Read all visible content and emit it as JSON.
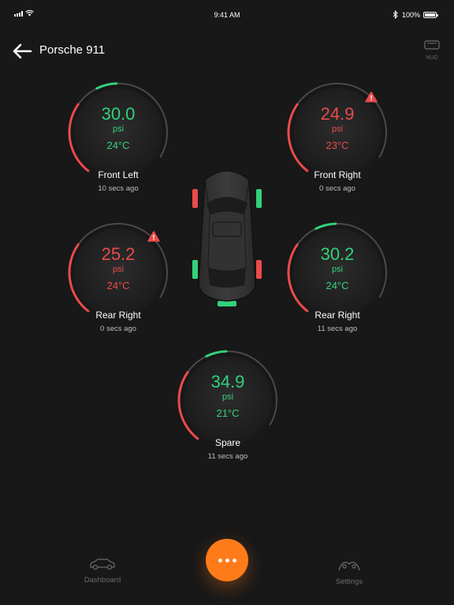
{
  "status": {
    "time": "9:41 AM",
    "battery": "100%"
  },
  "header": {
    "title": "Porsche 911",
    "hud_label": "HUD"
  },
  "colors": {
    "ok": "#33d17a",
    "warn": "#ea4b4b",
    "accent": "#ff7b1a",
    "background": "#181818"
  },
  "tires": [
    {
      "id": "front-left",
      "name": "Front Left",
      "pressure": "30.0",
      "unit": "psi",
      "temp": "24°C",
      "updated": "10 secs ago",
      "status": "ok",
      "alert": false
    },
    {
      "id": "front-right",
      "name": "Front Right",
      "pressure": "24.9",
      "unit": "psi",
      "temp": "23°C",
      "updated": "0 secs ago",
      "status": "warn",
      "alert": true
    },
    {
      "id": "rear-left",
      "name": "Rear Right",
      "pressure": "25.2",
      "unit": "psi",
      "temp": "24°C",
      "updated": "0 secs ago",
      "status": "warn",
      "alert": true
    },
    {
      "id": "rear-right",
      "name": "Rear Right",
      "pressure": "30.2",
      "unit": "psi",
      "temp": "24°C",
      "updated": "11 secs ago",
      "status": "ok",
      "alert": false
    },
    {
      "id": "spare",
      "name": "Spare",
      "pressure": "34.9",
      "unit": "psi",
      "temp": "21°C",
      "updated": "11 secs ago",
      "status": "ok",
      "alert": false
    }
  ],
  "car_wheels": {
    "front_left": "warn",
    "front_right": "ok",
    "rear_left": "ok",
    "rear_right": "warn",
    "spare": "ok"
  },
  "tabbar": {
    "dashboard_label": "Dashboard",
    "settings_label": "Settings",
    "more_icon": "more-dots-icon"
  }
}
